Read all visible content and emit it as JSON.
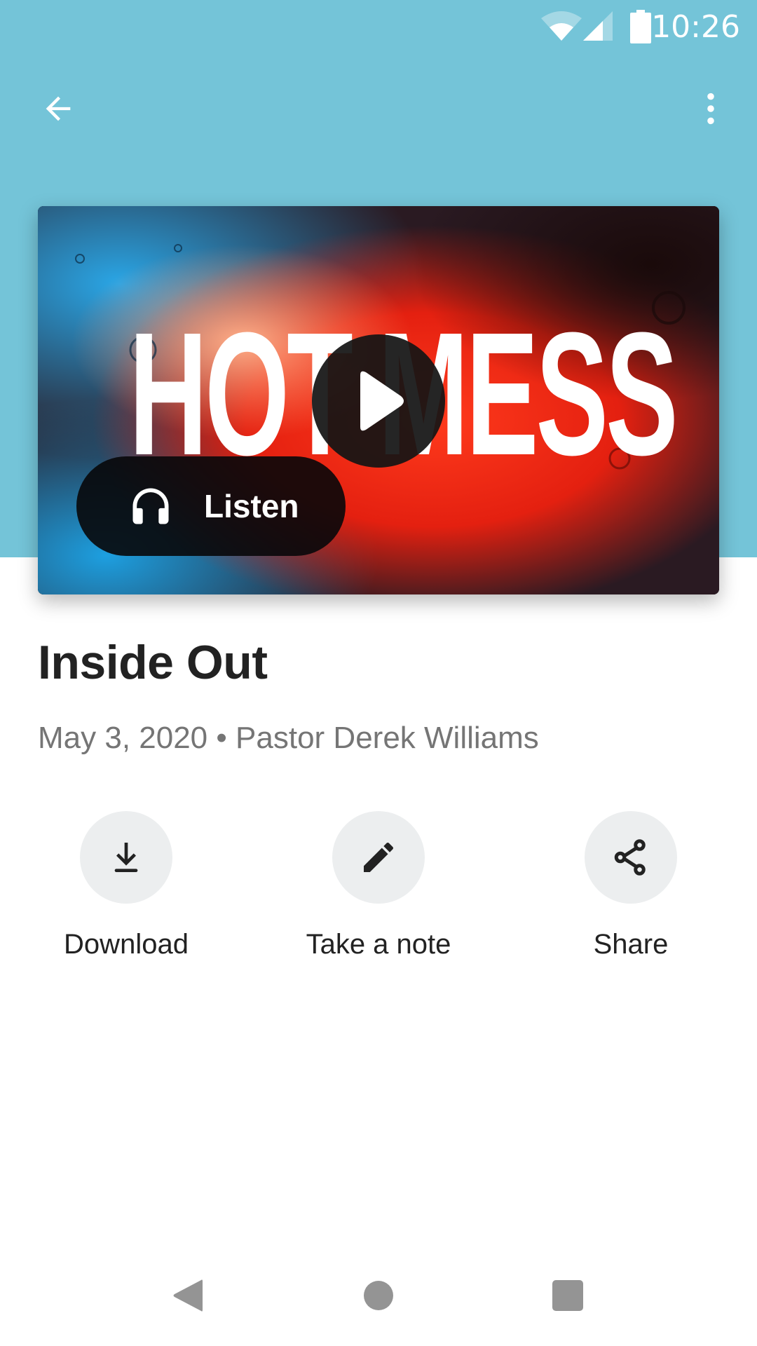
{
  "colors": {
    "header_bg": "#74c4d8",
    "title_text": "#222222",
    "meta_text": "#757575",
    "action_circle_bg": "#eceeef",
    "nav_icon": "#949494"
  },
  "status_bar": {
    "time": "10:26",
    "icons": [
      "wifi-icon",
      "cell-signal-icon",
      "battery-icon"
    ]
  },
  "toolbar": {
    "back_icon": "arrow-back-icon",
    "menu_icon": "more-vert-icon"
  },
  "media": {
    "artwork_title": "HOT MESS",
    "play_icon": "play-icon",
    "listen_label": "Listen",
    "listen_icon": "headphones-icon"
  },
  "sermon": {
    "title": "Inside Out",
    "date": "May 3, 2020",
    "separator": "•",
    "speaker": "Pastor Derek Williams",
    "meta_line": "May 3, 2020 • Pastor Derek Williams"
  },
  "actions": [
    {
      "label": "Download",
      "icon": "download-icon"
    },
    {
      "label": "Take a note",
      "icon": "pencil-icon"
    },
    {
      "label": "Share",
      "icon": "share-icon"
    }
  ],
  "nav_bar": {
    "buttons": [
      "nav-back-icon",
      "nav-home-icon",
      "nav-recents-icon"
    ]
  }
}
